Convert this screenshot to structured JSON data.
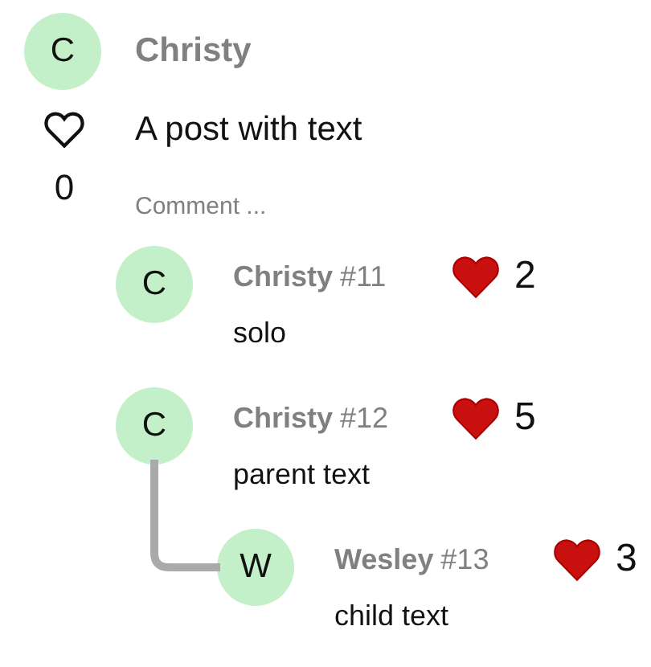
{
  "post": {
    "author": {
      "initial": "C",
      "name": "Christy"
    },
    "text": "A post with text",
    "liked": false,
    "likes": "0",
    "comment_placeholder": "Comment ..."
  },
  "comments": [
    {
      "initial": "C",
      "name": "Christy",
      "number": "#11",
      "liked": true,
      "likes": "2",
      "text": "solo"
    },
    {
      "initial": "C",
      "name": "Christy",
      "number": "#12",
      "liked": true,
      "likes": "5",
      "text": "parent text",
      "children": [
        {
          "initial": "W",
          "name": "Wesley",
          "number": "#13",
          "liked": true,
          "likes": "3",
          "text": "child text"
        }
      ]
    }
  ]
}
